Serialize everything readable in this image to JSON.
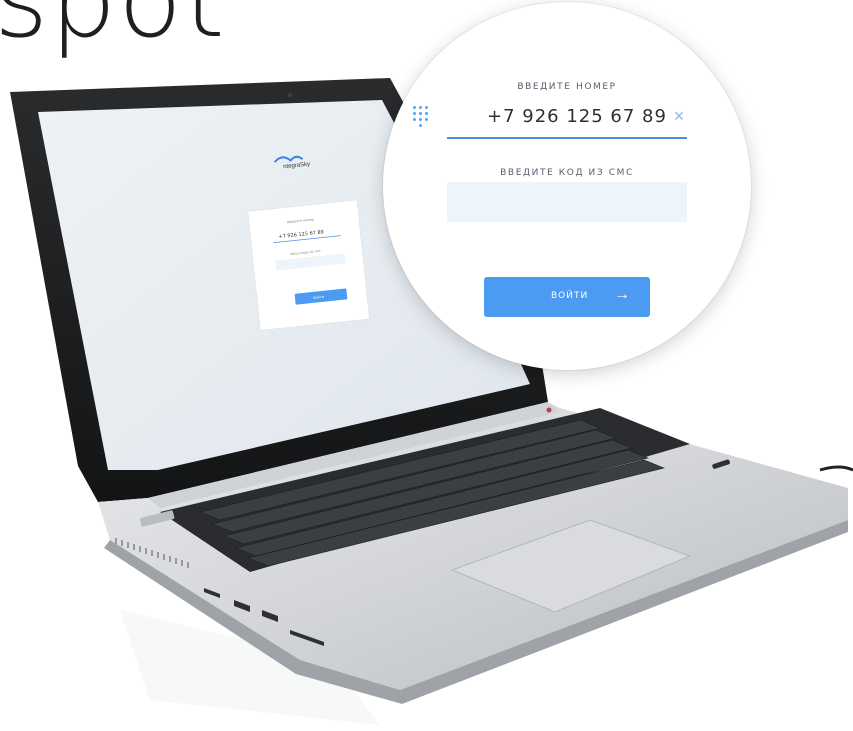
{
  "headline": "spot",
  "screen": {
    "brand": "ntegraSky",
    "card": {
      "phone_label": "введите номер",
      "phone_value": "+7 926 125 67 89",
      "sms_label": "ввод кода из смс",
      "button_label": "войти"
    }
  },
  "magnifier": {
    "phone_label": "ВВЕДИТЕ НОМЕР",
    "phone_value": "+7 926 125 67 89",
    "sms_label": "ВВЕДИТЕ КОД ИЗ СМС",
    "button_label": "ВОЙТИ",
    "button_arrow": "→",
    "clear_icon": "×"
  },
  "colors": {
    "accent": "#4a9bf1",
    "field_bg": "#edf4fb",
    "underline": "#4a90e2"
  }
}
